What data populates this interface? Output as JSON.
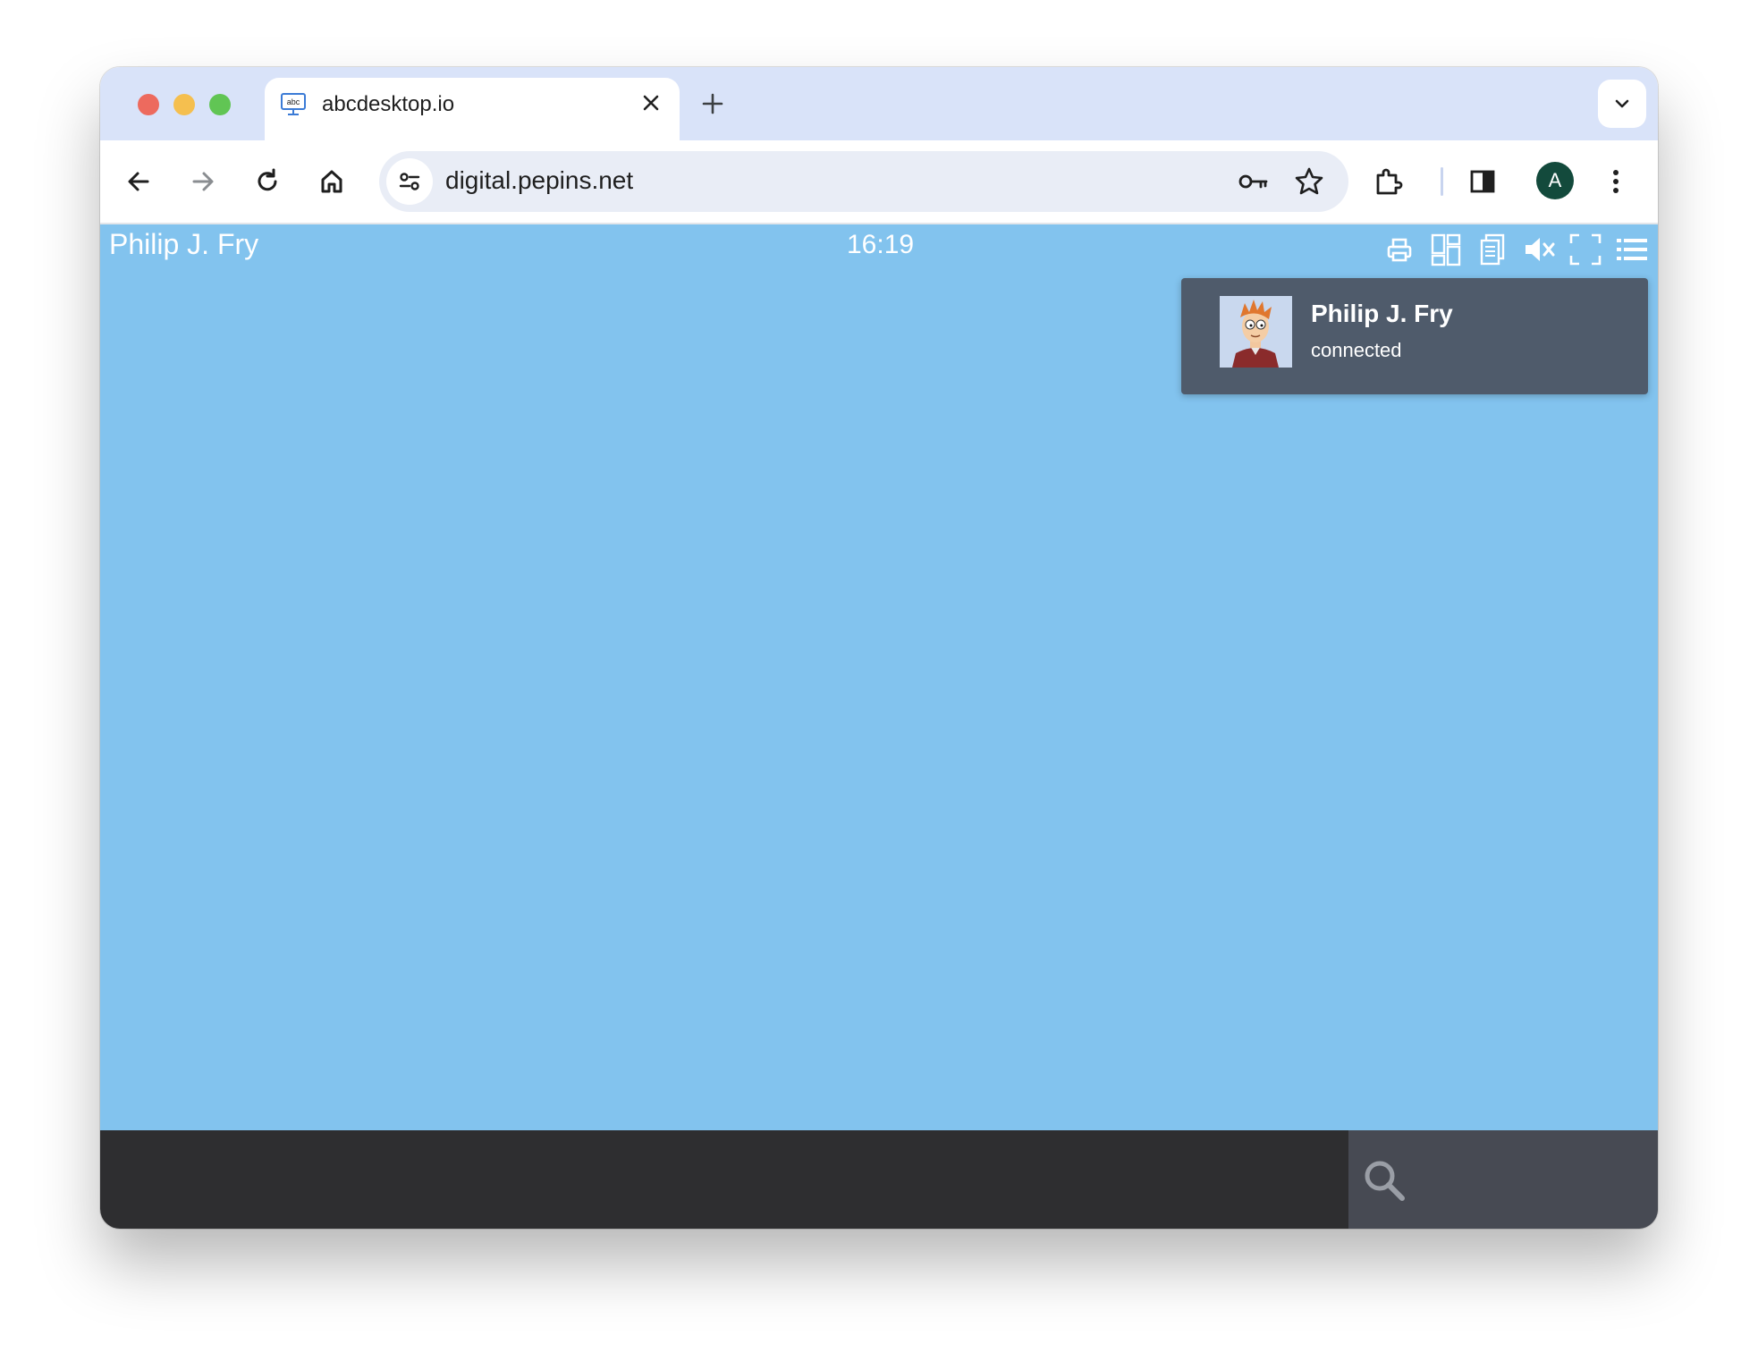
{
  "browser": {
    "tab": {
      "title": "abcdesktop.io",
      "favicon_text": "abc"
    },
    "address_bar": {
      "url": "digital.pepins.net"
    },
    "profile_initial": "A"
  },
  "desktop": {
    "user_name": "Philip J. Fry",
    "clock": "16:19",
    "background_color": "#82c3ee",
    "toolbar_icons": [
      "printer-icon",
      "apps-grid-icon",
      "clipboard-icon",
      "mute-icon",
      "fullscreen-icon",
      "menu-list-icon"
    ]
  },
  "notification": {
    "title": "Philip J. Fry",
    "status": "connected"
  },
  "dock": {
    "search_icon": "search-icon"
  },
  "colors": {
    "tabstrip": "#d9e3f9",
    "dock": "#2e2e30",
    "dock_search": "#474a53",
    "notification": "#4f5b6b",
    "avatar": "#134a3c"
  }
}
